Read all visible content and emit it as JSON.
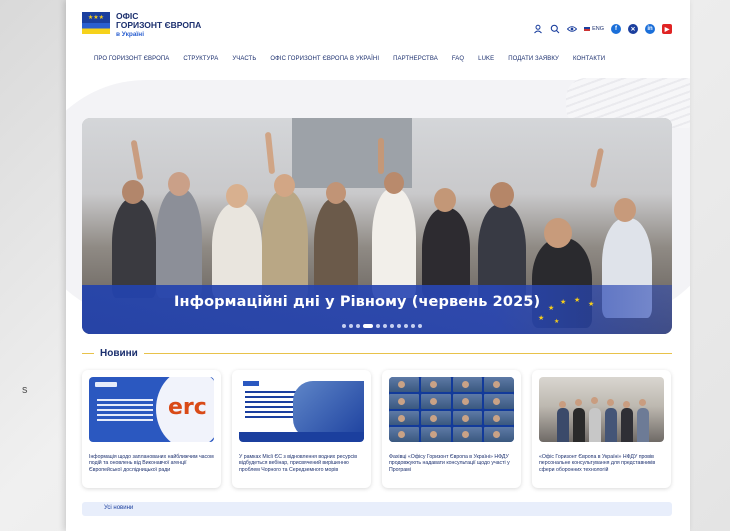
{
  "background": {
    "edge_text": "s"
  },
  "header": {
    "logo": {
      "line1": "ОФІС",
      "line2": "ГОРИЗОНТ ЄВРОПА",
      "line3": "в Україні"
    },
    "lang_label": "ENG",
    "tools": [
      {
        "icon": "user-icon"
      },
      {
        "icon": "search-icon"
      },
      {
        "icon": "eye-icon"
      }
    ],
    "social": [
      {
        "icon": "facebook-icon",
        "color": "#1b6fd9",
        "glyph": "f"
      },
      {
        "icon": "x-icon",
        "color": "#1b3f9e",
        "glyph": "✕"
      },
      {
        "icon": "linkedin-icon",
        "color": "#1b6fd9",
        "glyph": "in"
      },
      {
        "icon": "youtube-icon",
        "color": "#e02424",
        "glyph": "▶"
      }
    ]
  },
  "nav": {
    "items": [
      "ПРО ГОРИЗОНТ ЄВРОПА",
      "СТРУКТУРА",
      "УЧАСТЬ",
      "ОФІС ГОРИЗОНТ ЄВРОПА В УКРАЇНІ",
      "ПАРТНЕРСТВА",
      "FAQ",
      "LUKE",
      "ПОДАТИ ЗАЯВКУ",
      "КОНТАКТИ"
    ]
  },
  "hero": {
    "title": "Інформаційні дні у Рівному (червень 2025)",
    "dots_total": 11,
    "dots_active_index": 3
  },
  "news": {
    "section_title": "Новини",
    "cards": [
      {
        "text": "Інформація щодо запланованих найближчим часом подій та оновлень від Виконавчої агенції Європейської дослідницької ради",
        "thumb_label": "erc"
      },
      {
        "text": "У рамках Місії ЄС з відновлення водних ресурсів відбудеться вебінар, присвячений вирішенню проблем Чорного та Середземного морів",
        "thumb_label": ""
      },
      {
        "text": "Фахівці «Офісу Горизонт Європа в Україні» НФДУ продовжують надавати консультації щодо участі у Програмі",
        "thumb_label": ""
      },
      {
        "text": "«Офіс Горизонт Європа в Україні» НФДУ провів персональне консультування для представників сфери оборонних технологій",
        "thumb_label": ""
      }
    ],
    "all_news_label": "Усі новини"
  },
  "colors": {
    "brand_blue": "#1b3f9e",
    "accent_gold": "#e8c24a",
    "hero_band": "#2242ad"
  }
}
